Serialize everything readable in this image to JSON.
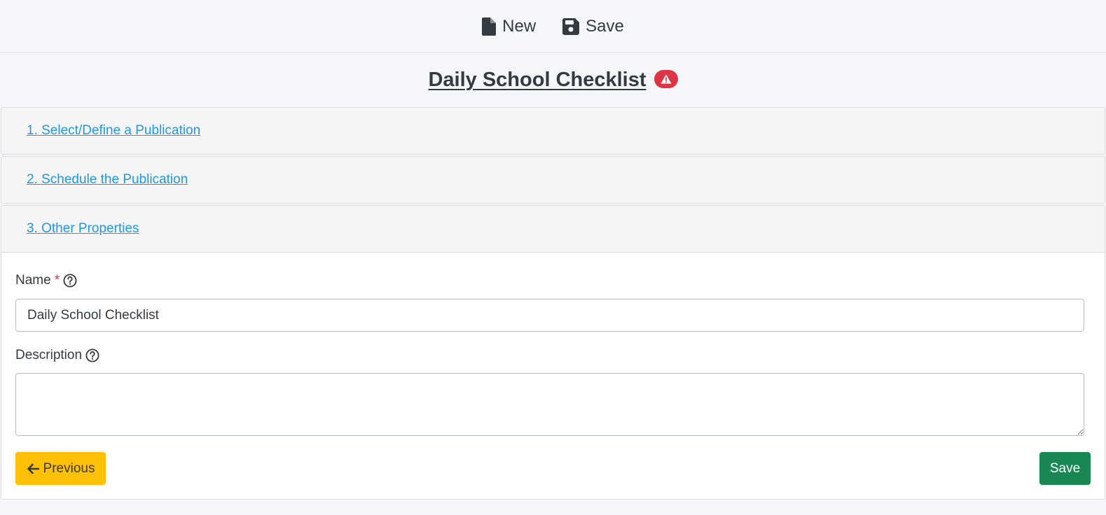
{
  "toolbar": {
    "new_label": "New",
    "new_icon": "file-icon",
    "save_label": "Save",
    "save_icon": "floppy-disk-icon"
  },
  "header": {
    "title": "Daily School Checklist",
    "alert_icon": "warning-triangle-icon",
    "alert_color": "#dc3545"
  },
  "accordion": {
    "sections": [
      {
        "label": "1. Select/Define a Publication"
      },
      {
        "label": "2. Schedule the Publication"
      },
      {
        "label": "3. Other Properties"
      }
    ]
  },
  "form": {
    "name_label": "Name",
    "required_marker": "*",
    "name_value": "Daily School Checklist",
    "description_label": "Description",
    "description_value": "",
    "help_icon": "question-circle-icon"
  },
  "actions": {
    "previous_label": "Previous",
    "previous_icon": "arrow-left-icon",
    "previous_color": "#ffc107",
    "save_label": "Save",
    "save_color": "#198754"
  },
  "colors": {
    "link": "#2196e3",
    "text": "#333a40",
    "background": "#f4f6f9"
  }
}
